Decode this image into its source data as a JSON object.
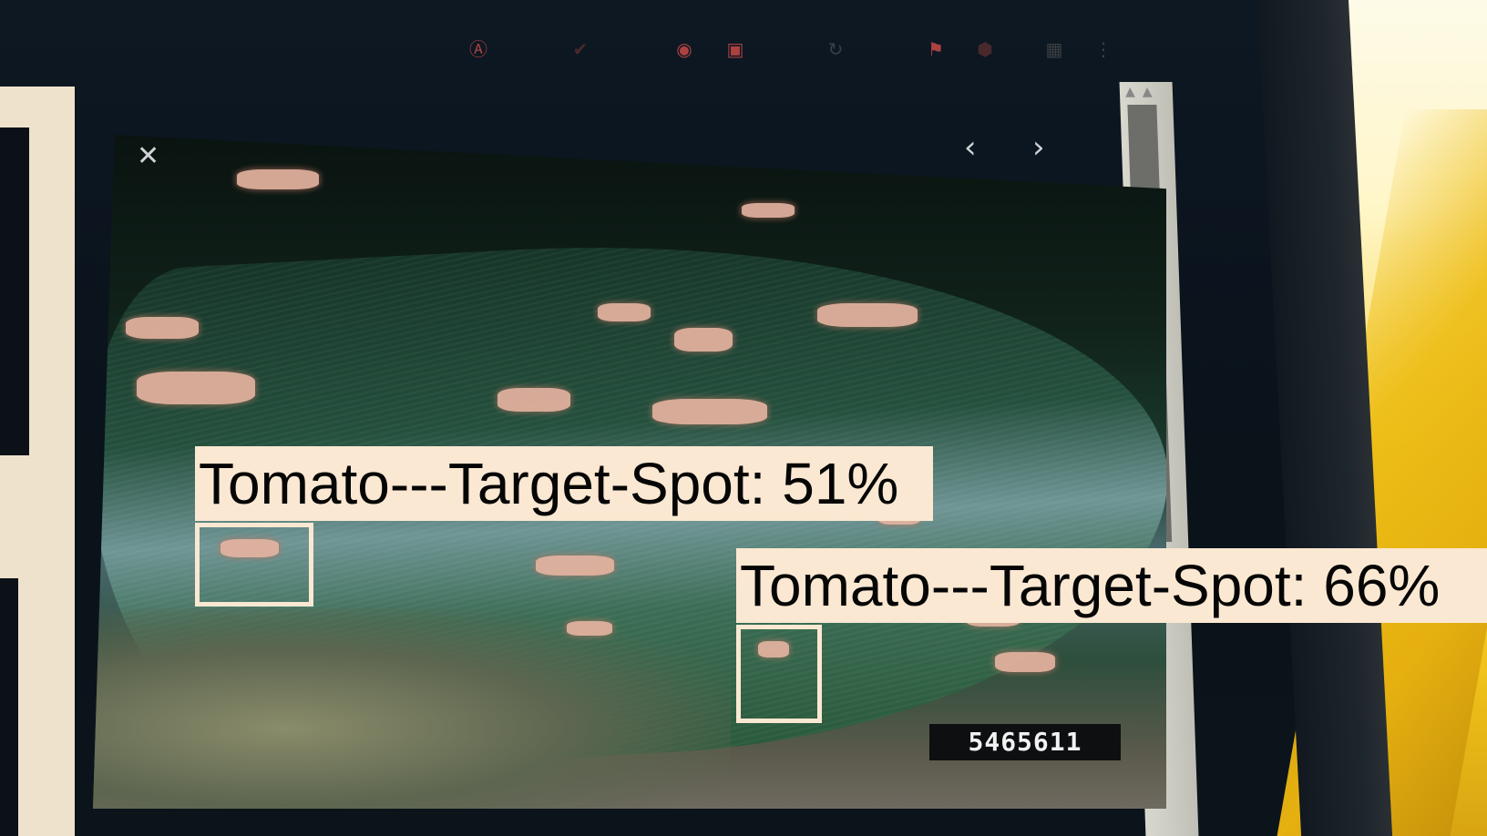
{
  "viewer": {
    "close_icon": "close-icon",
    "prev_icon": "chevron-left-icon",
    "next_icon": "chevron-right-icon",
    "image_id": "5465611"
  },
  "toolbar": {
    "icons": [
      "spellcheck-icon",
      "checkmark-icon",
      "record-icon",
      "frame-icon",
      "refresh-icon",
      "flag-icon",
      "shield-icon",
      "extension-icon",
      "more-icon"
    ]
  },
  "detections": [
    {
      "label": "Tomato---Target-Spot: 51%",
      "class": "Tomato---Target-Spot",
      "confidence": 51
    },
    {
      "label": "Tomato---Target-Spot: 66%",
      "class": "Tomato---Target-Spot",
      "confidence": 66
    }
  ],
  "colors": {
    "label_bg": "#fbe8d2",
    "label_text": "#060606",
    "box_border": "#fbe8d2"
  }
}
